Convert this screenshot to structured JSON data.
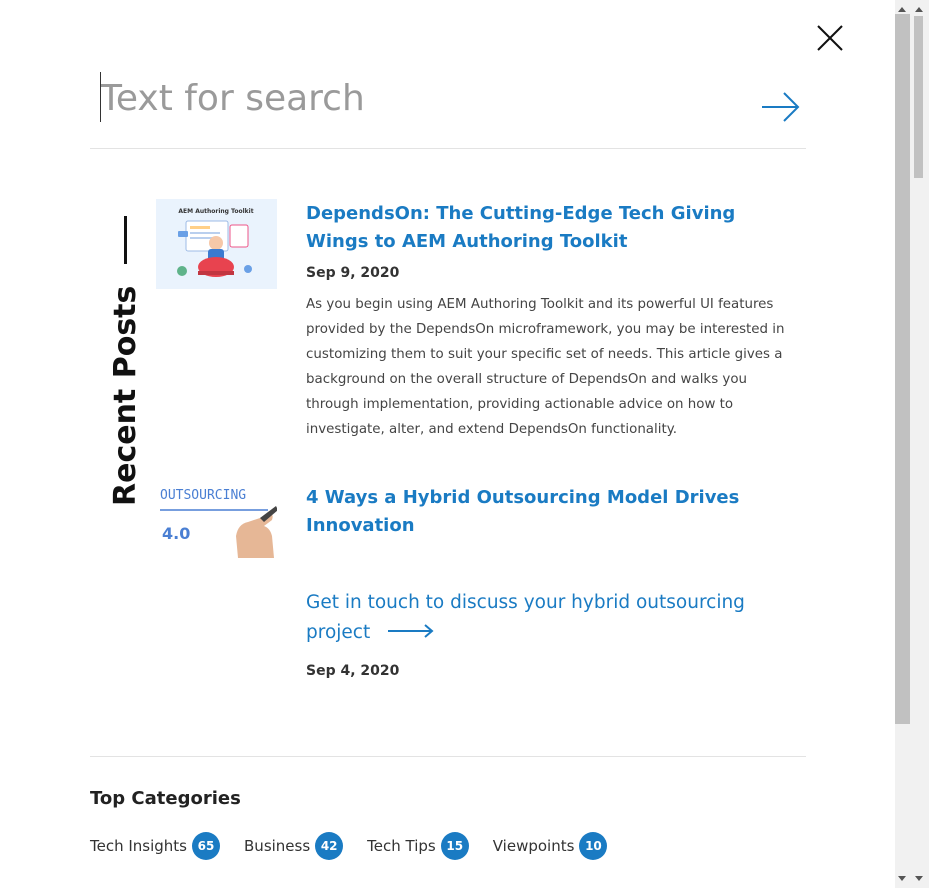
{
  "search": {
    "placeholder": "Text for search",
    "value": ""
  },
  "icons": {
    "close": "close-icon",
    "submit": "arrow-right-icon",
    "cta_arrow": "long-arrow-right-icon"
  },
  "recent_posts": {
    "label": "Recent Posts",
    "posts": [
      {
        "thumbnail_caption": "AEM Authoring Toolkit",
        "title": "DependsOn: The Cutting-Edge Tech Giving Wings to AEM Authoring Toolkit",
        "date": "Sep 9, 2020",
        "excerpt": "As you begin using AEM Authoring Toolkit and its powerful UI features provided by the DependsOn microframework, you may be interested in customizing them to suit your specific set of needs. This article gives a background on the overall structure of DependsOn and walks you through implementation, providing actionable advice on how to investigate, alter, and extend DependsOn functionality."
      },
      {
        "thumbnail_caption": "OUTSOURCING",
        "thumbnail_subcaption": "4.0",
        "title": "4 Ways a Hybrid Outsourcing Model Drives Innovation",
        "cta": "Get in touch to discuss your hybrid outsourcing project",
        "date": "Sep 4, 2020"
      }
    ]
  },
  "top_categories": {
    "heading": "Top Categories",
    "items": [
      {
        "label": "Tech Insights",
        "count": "65"
      },
      {
        "label": "Business",
        "count": "42"
      },
      {
        "label": "Tech Tips",
        "count": "15"
      },
      {
        "label": "Viewpoints",
        "count": "10"
      }
    ]
  },
  "colors": {
    "accent": "#1a7bc3",
    "text": "#222222",
    "placeholder": "#9a9a9a"
  }
}
